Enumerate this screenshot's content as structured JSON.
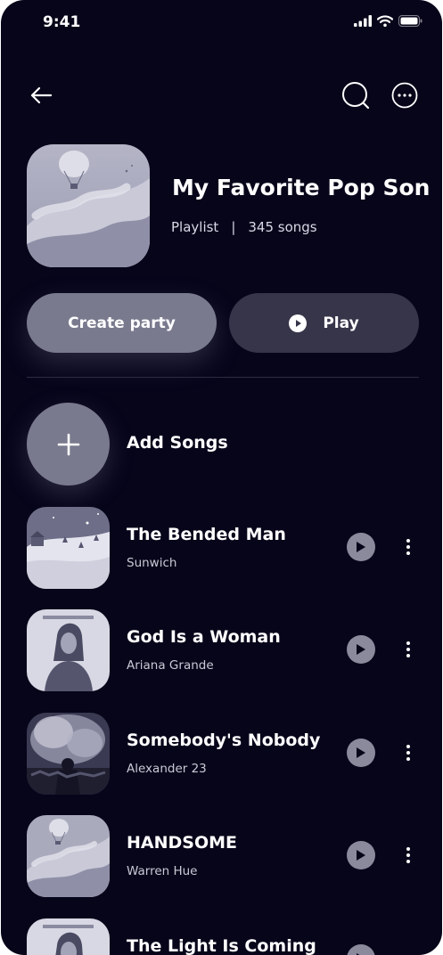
{
  "status_bar": {
    "time": "9:41",
    "icons": [
      "signal-icon",
      "wifi-icon",
      "battery-icon"
    ]
  },
  "header": {
    "back_icon": "arrow-left-icon",
    "search_icon": "search-icon",
    "more_icon": "more-horizontal-icon"
  },
  "playlist": {
    "title": "My Favorite Pop Son..",
    "type": "Playlist",
    "separator": "|",
    "count": "345 songs"
  },
  "actions": {
    "create_party": "Create party",
    "play": "Play"
  },
  "add_songs": {
    "label": "Add Songs",
    "icon": "plus-icon"
  },
  "songs": [
    {
      "title": "The Bended Man",
      "artist": "Sunwich",
      "art": "winter-village"
    },
    {
      "title": "God Is a Woman",
      "artist": "Ariana Grande",
      "art": "portrait"
    },
    {
      "title": "Somebody's Nobody",
      "artist": "Alexander 23",
      "art": "smoke-crowd"
    },
    {
      "title": "HANDSOME",
      "artist": "Warren Hue",
      "art": "balloon-clouds"
    },
    {
      "title": "The Light Is Coming",
      "artist": "",
      "art": "portrait"
    }
  ],
  "colors": {
    "background": "#07051a",
    "primary_button": "#7a7a8f",
    "secondary_button": "#37354a",
    "text": "#ffffff",
    "muted_text": "#d8d8e6"
  }
}
